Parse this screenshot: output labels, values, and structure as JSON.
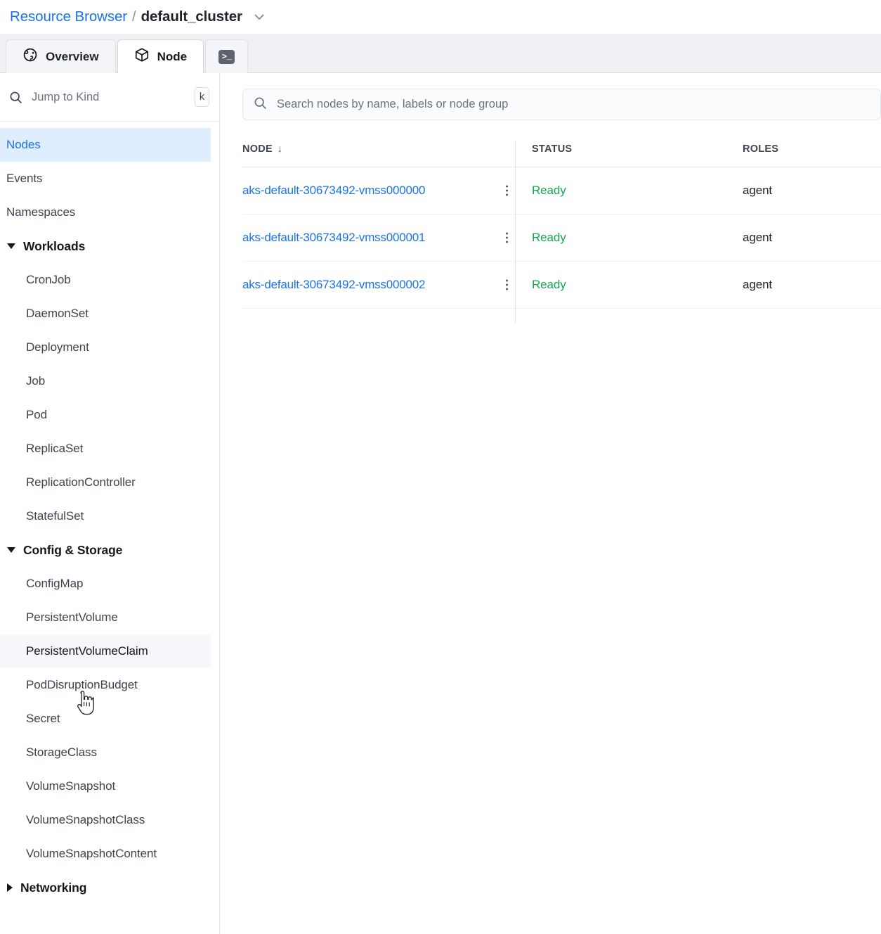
{
  "breadcrumb": {
    "root_label": "Resource Browser",
    "separator": "/",
    "current_label": "default_cluster",
    "chevron_icon": "chevron-down-icon"
  },
  "tabs": [
    {
      "label": "Overview",
      "icon": "globe-icon",
      "active": false
    },
    {
      "label": "Node",
      "icon": "cube-icon",
      "active": true
    },
    {
      "label": "",
      "icon": "terminal-icon",
      "glyph": ">_",
      "active": false
    }
  ],
  "sidebar": {
    "search": {
      "placeholder": "Jump to Kind",
      "value": "",
      "icon": "search-icon",
      "shortcut_key": "k"
    },
    "items": [
      {
        "label": "Nodes",
        "kind": "item",
        "state": "selected"
      },
      {
        "label": "Events",
        "kind": "item",
        "state": "normal"
      },
      {
        "label": "Namespaces",
        "kind": "item",
        "state": "normal"
      },
      {
        "label": "Workloads",
        "kind": "group",
        "expanded": true
      },
      {
        "label": "CronJob",
        "kind": "child",
        "state": "normal"
      },
      {
        "label": "DaemonSet",
        "kind": "child",
        "state": "normal"
      },
      {
        "label": "Deployment",
        "kind": "child",
        "state": "normal"
      },
      {
        "label": "Job",
        "kind": "child",
        "state": "normal"
      },
      {
        "label": "Pod",
        "kind": "child",
        "state": "normal"
      },
      {
        "label": "ReplicaSet",
        "kind": "child",
        "state": "normal"
      },
      {
        "label": "ReplicationController",
        "kind": "child",
        "state": "normal"
      },
      {
        "label": "StatefulSet",
        "kind": "child",
        "state": "normal"
      },
      {
        "label": "Config & Storage",
        "kind": "group",
        "expanded": true
      },
      {
        "label": "ConfigMap",
        "kind": "child",
        "state": "normal"
      },
      {
        "label": "PersistentVolume",
        "kind": "child",
        "state": "normal"
      },
      {
        "label": "PersistentVolumeClaim",
        "kind": "child",
        "state": "hovered"
      },
      {
        "label": "PodDisruptionBudget",
        "kind": "child",
        "state": "normal"
      },
      {
        "label": "Secret",
        "kind": "child",
        "state": "normal"
      },
      {
        "label": "StorageClass",
        "kind": "child",
        "state": "normal"
      },
      {
        "label": "VolumeSnapshot",
        "kind": "child",
        "state": "normal"
      },
      {
        "label": "VolumeSnapshotClass",
        "kind": "child",
        "state": "normal"
      },
      {
        "label": "VolumeSnapshotContent",
        "kind": "child",
        "state": "normal"
      },
      {
        "label": "Networking",
        "kind": "group",
        "expanded": false
      }
    ]
  },
  "main": {
    "search": {
      "placeholder": "Search nodes by name, labels or node group",
      "value": "",
      "icon": "search-icon"
    },
    "table": {
      "columns": [
        {
          "label": "NODE",
          "sorted": true,
          "sort_glyph": "↓"
        },
        {
          "label": "STATUS",
          "sorted": false
        },
        {
          "label": "ROLES",
          "sorted": false
        }
      ],
      "rows": [
        {
          "node": "aks-default-30673492-vmss000000",
          "status": "Ready",
          "roles": "agent"
        },
        {
          "node": "aks-default-30673492-vmss000001",
          "status": "Ready",
          "roles": "agent"
        },
        {
          "node": "aks-default-30673492-vmss000002",
          "status": "Ready",
          "roles": "agent"
        }
      ],
      "row_menu_icon": "kebab-menu-icon"
    }
  },
  "cursor": {
    "icon": "hand-pointer-cursor"
  },
  "colors": {
    "link": "#1a73e8",
    "selected_bg": "#deeeff",
    "status_ready": "#17a550",
    "tabbar_bg": "#eef0f4",
    "terminal_icon_bg": "#5c636e"
  }
}
